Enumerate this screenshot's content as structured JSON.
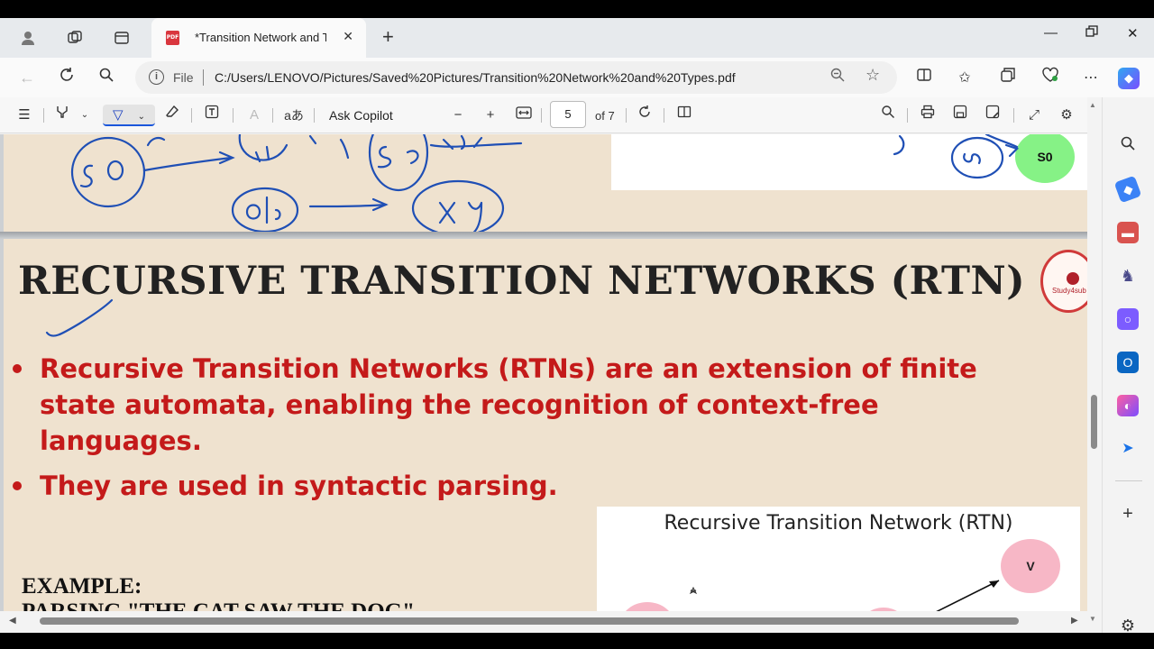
{
  "tab": {
    "title": "*Transition Network and Types.pdf",
    "pdf_icon": "PDF"
  },
  "address": {
    "file_label": "File",
    "url": "C:/Users/LENOVO/Pictures/Saved%20Pictures/Transition%20Network%20and%20Types.pdf"
  },
  "pdf_toolbar": {
    "translate_glyph": "aあ",
    "ask_copilot": "Ask Copilot",
    "current_page": "5",
    "page_total": "of 7"
  },
  "document": {
    "top_node": "S0",
    "heading": "RECURSIVE TRANSITION NETWORKS (RTN)",
    "bullets": [
      "Recursive Transition Networks (RTNs) are an extension of finite state automata, enabling the recognition of context-free languages.",
      "They are used in syntactic parsing."
    ],
    "example_label": "EXAMPLE:",
    "example_text": "PARSING \"THE CAT SAW THE DOG\"",
    "diagram_title": "Recursive Transition Network (RTN)",
    "diagram_node_v": "V",
    "logo_text": "Study4sub"
  },
  "colors": {
    "bullet_red": "#c41a1a",
    "page_bg": "#efe2cf",
    "ink_blue": "#1f4fb5",
    "s0_green": "#86f286",
    "node_pink": "#f7b7c6"
  }
}
